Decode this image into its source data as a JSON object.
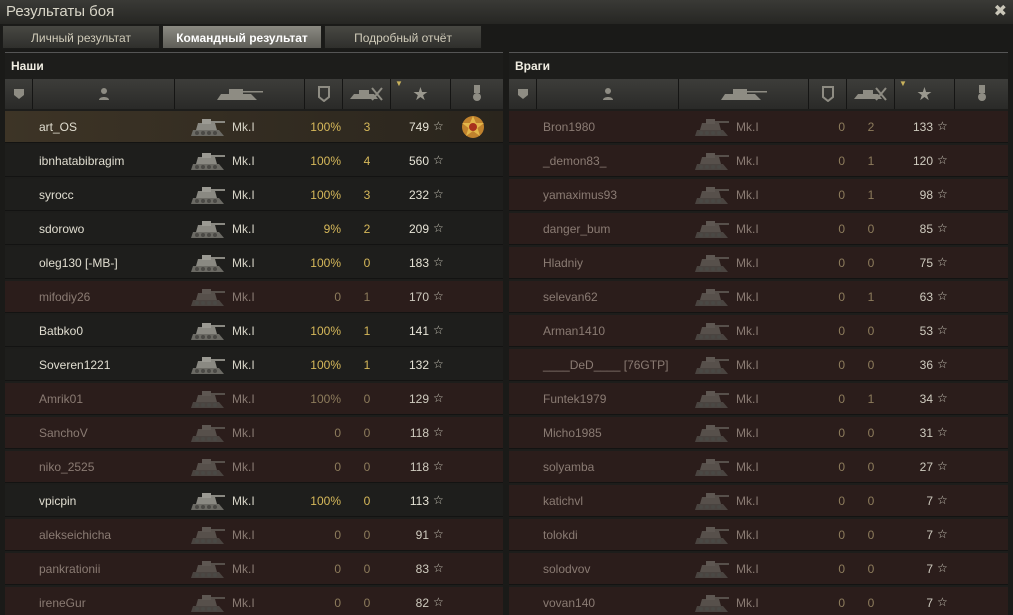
{
  "window": {
    "title": "Результаты боя"
  },
  "tabs": [
    {
      "label": "Личный результат",
      "active": false
    },
    {
      "label": "Командный результат",
      "active": true
    },
    {
      "label": "Подробный отчёт",
      "active": false
    }
  ],
  "columns_icons": [
    "rank-icon",
    "player-icon",
    "tank-icon",
    "survival-icon",
    "frags-icon",
    "experience-icon",
    "medal-icon"
  ],
  "colors": {
    "accent": "#d6b85a",
    "dead_row": "#2b1d1b",
    "highlight_row": "#3d3426"
  },
  "allies": {
    "title": "Наши",
    "rows": [
      {
        "name": "art_OS",
        "tank": "Mk.I",
        "survival": "100%",
        "kills": "3",
        "xp": "749",
        "alive": true,
        "highlight": true,
        "medal": true
      },
      {
        "name": "ibnhatabibragim",
        "tank": "Mk.I",
        "survival": "100%",
        "kills": "4",
        "xp": "560",
        "alive": true
      },
      {
        "name": "syrocc",
        "tank": "Mk.I",
        "survival": "100%",
        "kills": "3",
        "xp": "232",
        "alive": true
      },
      {
        "name": "sdorowo",
        "tank": "Mk.I",
        "survival": "9%",
        "kills": "2",
        "xp": "209",
        "alive": true
      },
      {
        "name": "oleg130 [-MB-]",
        "tank": "Mk.I",
        "survival": "100%",
        "kills": "0",
        "xp": "183",
        "alive": true
      },
      {
        "name": "mifodiy26",
        "tank": "Mk.I",
        "survival": "0",
        "kills": "1",
        "xp": "170",
        "alive": false
      },
      {
        "name": "Batbko0",
        "tank": "Mk.I",
        "survival": "100%",
        "kills": "1",
        "xp": "141",
        "alive": true
      },
      {
        "name": "Soveren1221",
        "tank": "Mk.I",
        "survival": "100%",
        "kills": "1",
        "xp": "132",
        "alive": true
      },
      {
        "name": "Amrik01",
        "tank": "Mk.I",
        "survival": "100%",
        "kills": "0",
        "xp": "129",
        "alive": false
      },
      {
        "name": "SanchoV",
        "tank": "Mk.I",
        "survival": "0",
        "kills": "0",
        "xp": "118",
        "alive": false
      },
      {
        "name": "niko_2525",
        "tank": "Mk.I",
        "survival": "0",
        "kills": "0",
        "xp": "118",
        "alive": false
      },
      {
        "name": "vpicpin",
        "tank": "Mk.I",
        "survival": "100%",
        "kills": "0",
        "xp": "113",
        "alive": true
      },
      {
        "name": "alekseichicha",
        "tank": "Mk.I",
        "survival": "0",
        "kills": "0",
        "xp": "91",
        "alive": false
      },
      {
        "name": "pankrationii",
        "tank": "Mk.I",
        "survival": "0",
        "kills": "0",
        "xp": "83",
        "alive": false
      },
      {
        "name": "ireneGur",
        "tank": "Mk.I",
        "survival": "0",
        "kills": "0",
        "xp": "82",
        "alive": false
      }
    ]
  },
  "enemies": {
    "title": "Враги",
    "rows": [
      {
        "name": "Bron1980",
        "tank": "Mk.I",
        "survival": "0",
        "kills": "2",
        "xp": "133",
        "alive": false
      },
      {
        "name": "_demon83_",
        "tank": "Mk.I",
        "survival": "0",
        "kills": "1",
        "xp": "120",
        "alive": false
      },
      {
        "name": "yamaximus93",
        "tank": "Mk.I",
        "survival": "0",
        "kills": "1",
        "xp": "98",
        "alive": false
      },
      {
        "name": "danger_bum",
        "tank": "Mk.I",
        "survival": "0",
        "kills": "0",
        "xp": "85",
        "alive": false
      },
      {
        "name": "Hladniy",
        "tank": "Mk.I",
        "survival": "0",
        "kills": "0",
        "xp": "75",
        "alive": false
      },
      {
        "name": "selevan62",
        "tank": "Mk.I",
        "survival": "0",
        "kills": "1",
        "xp": "63",
        "alive": false
      },
      {
        "name": "Arman1410",
        "tank": "Mk.I",
        "survival": "0",
        "kills": "0",
        "xp": "53",
        "alive": false
      },
      {
        "name": "____DeD____ [76GTP]",
        "tank": "Mk.I",
        "survival": "0",
        "kills": "0",
        "xp": "36",
        "alive": false
      },
      {
        "name": "Funtek1979",
        "tank": "Mk.I",
        "survival": "0",
        "kills": "1",
        "xp": "34",
        "alive": false
      },
      {
        "name": "Micho1985",
        "tank": "Mk.I",
        "survival": "0",
        "kills": "0",
        "xp": "31",
        "alive": false
      },
      {
        "name": "solyamba",
        "tank": "Mk.I",
        "survival": "0",
        "kills": "0",
        "xp": "27",
        "alive": false
      },
      {
        "name": "katichvl",
        "tank": "Mk.I",
        "survival": "0",
        "kills": "0",
        "xp": "7",
        "alive": false
      },
      {
        "name": "tolokdi",
        "tank": "Mk.I",
        "survival": "0",
        "kills": "0",
        "xp": "7",
        "alive": false
      },
      {
        "name": "solodvov",
        "tank": "Mk.I",
        "survival": "0",
        "kills": "0",
        "xp": "7",
        "alive": false
      },
      {
        "name": "vovan140",
        "tank": "Mk.I",
        "survival": "0",
        "kills": "0",
        "xp": "7",
        "alive": false
      }
    ]
  }
}
